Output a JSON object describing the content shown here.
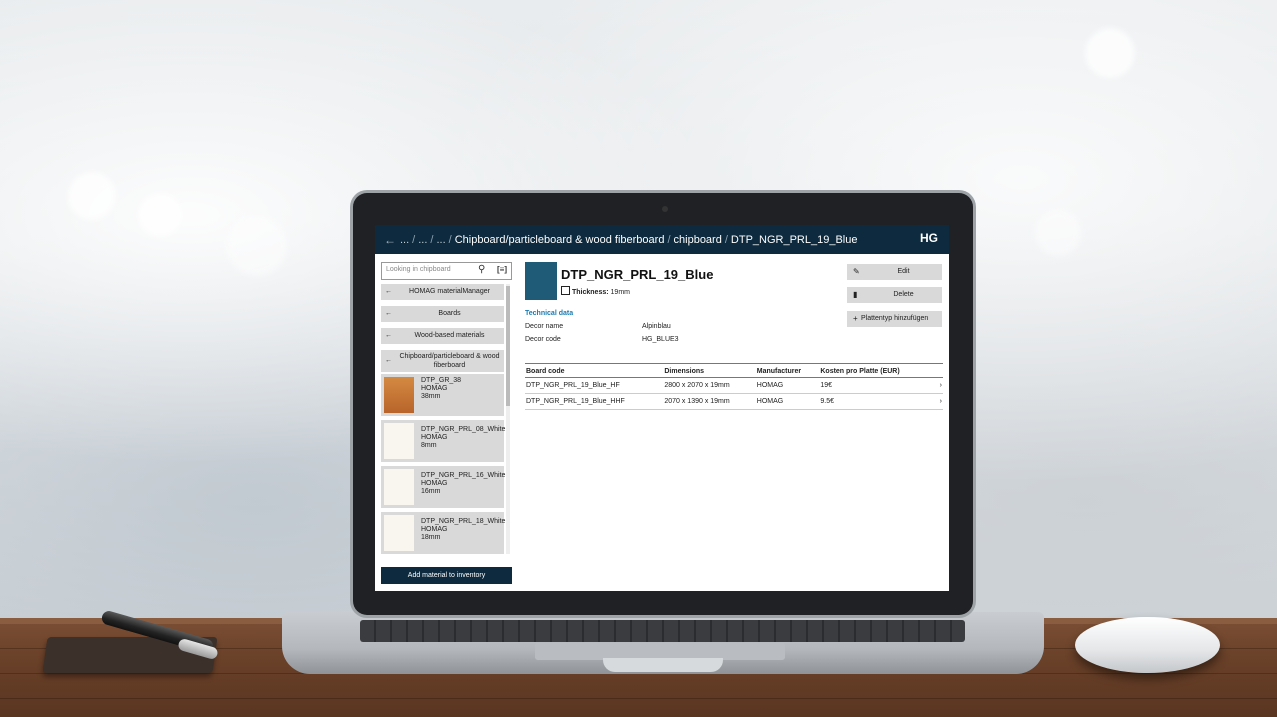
{
  "breadcrumb": {
    "back_icon": "arrow-left-icon",
    "ellipsis_1": "...",
    "ellipsis_2": "...",
    "ellipsis_3": "...",
    "sep": "/",
    "item_1": "Chipboard/particleboard & wood fiberboard",
    "item_2": "chipboard",
    "item_3": "DTP_NGR_PRL_19_Blue",
    "logo": "HG"
  },
  "sidebar": {
    "search_placeholder": "Looking in chipboard",
    "search_icon": "magnifier-icon",
    "scan_icon": "barcode-scan-icon",
    "nav": [
      {
        "arrow": "←",
        "label": "HOMAG materialManager"
      },
      {
        "arrow": "←",
        "label": "Boards"
      },
      {
        "arrow": "←",
        "label": "Wood-based materials"
      },
      {
        "arrow": "←",
        "label": "Chipboard/particleboard & wood fiberboard"
      }
    ],
    "items": [
      {
        "name": "DTP_GR_38",
        "maker": "HOMAG",
        "thickness": "38mm",
        "color": "#c4722e"
      },
      {
        "name": "DTP_NGR_PRL_08_White",
        "maker": "HOMAG",
        "thickness": "8mm",
        "color": "#f8f6ee"
      },
      {
        "name": "DTP_NGR_PRL_16_White",
        "maker": "HOMAG",
        "thickness": "16mm",
        "color": "#f8f6ee"
      },
      {
        "name": "DTP_NGR_PRL_18_White",
        "maker": "HOMAG",
        "thickness": "18mm",
        "color": "#f8f6ee"
      }
    ],
    "add_button": "Add material to inventory"
  },
  "detail": {
    "title": "DTP_NGR_PRL_19_Blue",
    "swatch_color": "#1f5a77",
    "thickness_label": "Thickness:",
    "thickness_value": "19mm",
    "technical_heading": "Technical data",
    "decor_name_label": "Decor name",
    "decor_name_value": "Alpinblau",
    "decor_code_label": "Decor code",
    "decor_code_value": "HG_BLUE3",
    "actions": {
      "edit": "Edit",
      "delete": "Delete",
      "add_type": "Plattentyp hinzufügen"
    },
    "table": {
      "headers": [
        "Board code",
        "Dimensions",
        "Manufacturer",
        "Kosten pro Platte (EUR)"
      ],
      "rows": [
        [
          "DTP_NGR_PRL_19_Blue_HF",
          "2800 x 2070 x 19mm",
          "HOMAG",
          "19€"
        ],
        [
          "DTP_NGR_PRL_19_Blue_HHF",
          "2070 x 1390 x 19mm",
          "HOMAG",
          "9.5€"
        ]
      ]
    }
  }
}
